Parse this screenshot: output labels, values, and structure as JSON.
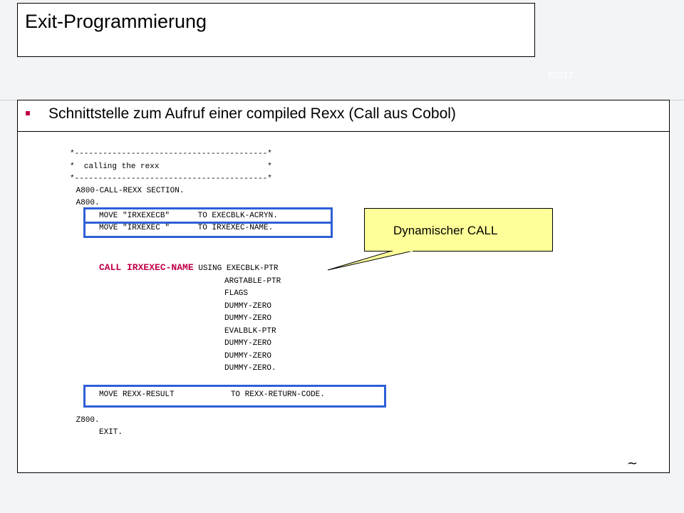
{
  "slide": {
    "title": "Exit-Programmierung",
    "ghost_label": "EXIT7",
    "bullet": "Schnittstelle zum Aufruf einer compiled Rexx (Call aus Cobol)",
    "callout": "Dynamischer CALL",
    "footer_mark": "~",
    "colors": {
      "accent": "#c0004a",
      "highlight_box": "#2e5fd6",
      "callout_fill": "#ffff99"
    }
  },
  "code": {
    "header_lines": [
      "*-----------------------------------------*",
      "*  calling the rexx                       *",
      "*-----------------------------------------*"
    ],
    "section": " A800-CALL-REXX SECTION.",
    "para": " A800.",
    "move1": "MOVE \"IRXEXECB\"      TO EXECBLK-ACRYN.",
    "move2": "MOVE \"IRXEXEC \"      TO IRXEXEC-NAME.",
    "call_keyword": "CALL IRXEXEC-NAME",
    "call_using": "USING EXECBLK-PTR",
    "args": [
      "ARGTABLE-PTR",
      "FLAGS",
      "DUMMY-ZERO",
      "DUMMY-ZERO",
      "EVALBLK-PTR",
      "DUMMY-ZERO",
      "DUMMY-ZERO",
      "DUMMY-ZERO."
    ],
    "move3": "MOVE REXX-RESULT            TO REXX-RETURN-CODE.",
    "z800": " Z800.",
    "exit": "EXIT."
  }
}
